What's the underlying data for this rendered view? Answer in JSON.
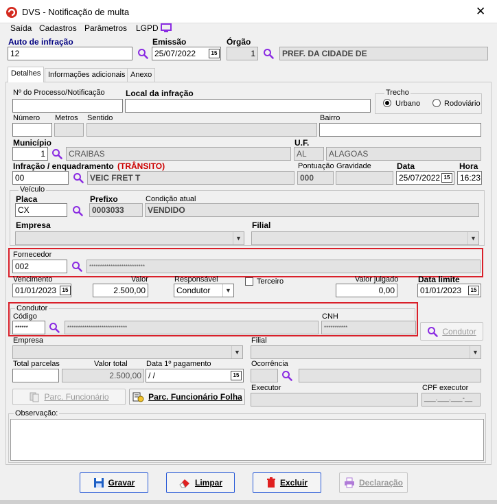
{
  "window": {
    "title": "DVS - Notificação de multa"
  },
  "menu": [
    "Saída",
    "Cadastros",
    "Parâmetros",
    "LGPD"
  ],
  "header": {
    "auto_label": "Auto de infração",
    "auto_value": "12",
    "emissao_label": "Emissão",
    "emissao_value": "25/07/2022",
    "orgao_label": "Órgão",
    "orgao_code": "1",
    "orgao_name": "PREF. DA CIDADE DE"
  },
  "tabs": [
    "Detalhes",
    "Informações adicionais",
    "Anexo"
  ],
  "details": {
    "processo_label": "Nº do Processo/Notificação",
    "processo_value": "",
    "local_label": "Local da infração",
    "local_value": "",
    "trecho_label": "Trecho",
    "urbano_label": "Urbano",
    "rodoviario_label": "Rodoviário",
    "numero_label": "Número",
    "metros_label": "Metros",
    "sentido_label": "Sentido",
    "bairro_label": "Bairro",
    "municipio_label": "Município",
    "municipio_code": "1",
    "municipio_name": "CRAIBAS",
    "uf_label": "U.F.",
    "uf_code": "AL",
    "uf_name": "ALAGOAS",
    "infracao_label": "Infração / enquadramento",
    "infracao_tag": "(TRÂNSITO)",
    "infracao_code": "00",
    "infracao_desc": "VEIC FRET T",
    "pontuacao_label": "Pontuação",
    "pontuacao_value": "000",
    "gravidade_label": "Gravidade",
    "data_label": "Data",
    "data_value": "25/07/2022",
    "hora_label": "Hora",
    "hora_value": "16:23"
  },
  "veiculo": {
    "group_label": "Veículo",
    "placa_label": "Placa",
    "placa_value": "CX",
    "prefixo_label": "Prefixo",
    "prefixo_value": "0003033",
    "condicao_label": "Condição atual",
    "condicao_value": "VENDIDO",
    "empresa_label": "Empresa",
    "filial_label": "Filial"
  },
  "fornecedor": {
    "label": "Fornecedor",
    "code": "002",
    "name": "**************************"
  },
  "financeiro": {
    "vencimento_label": "Vencimento",
    "vencimento_value": "01/01/2023",
    "valor_label": "Valor",
    "valor_value": "2.500,00",
    "responsavel_label": "Responsável",
    "responsavel_value": "Condutor",
    "terceiro_label": "Terceiro",
    "valor_julgado_label": "Valor julgado",
    "valor_julgado_value": "0,00",
    "data_limite_label": "Data limite",
    "data_limite_value": "01/01/2023"
  },
  "condutor": {
    "group_label": "Condutor",
    "codigo_label": "Código",
    "codigo_value": "******",
    "nome_value": "****************************",
    "cnh_label": "CNH",
    "cnh_value": "***********",
    "button_label": "Condutor"
  },
  "empresa2": {
    "empresa_label": "Empresa",
    "filial_label": "Filial"
  },
  "parcelas": {
    "total_parcelas_label": "Total parcelas",
    "valor_total_label": "Valor total",
    "valor_total_value": "2.500,00",
    "data_pagamento_label": "Data 1º pagamento",
    "data_pagamento_value": " / /",
    "ocorrencia_label": "Ocorrência",
    "executor_label": "Executor",
    "cpf_label": "CPF executor",
    "cpf_value": "___.___.___-__",
    "parc_funcionario_label": "Parc. Funcionário",
    "parc_folha_label": "Parc. Funcionário Folha"
  },
  "observacao_label": "Observação:",
  "buttons": {
    "gravar": "Gravar",
    "limpar": "Limpar",
    "excluir": "Excluir",
    "declaracao": "Declaração"
  },
  "colors": {
    "highlight": "#d9202a",
    "navy": "#000080",
    "red_label": "#cc0000",
    "purple_icon": "#8a2be2"
  }
}
